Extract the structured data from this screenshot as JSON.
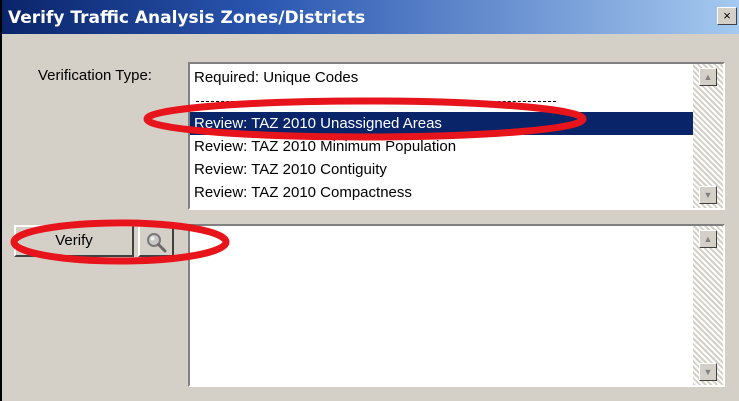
{
  "window": {
    "title": "Verify Traffic Analysis Zones/Districts",
    "close_glyph": "×"
  },
  "verification": {
    "label": "Verification Type:",
    "items": [
      {
        "label": "Required: Unique Codes",
        "selected": false
      },
      {
        "label": "Review: TAZ 2010 Unassigned Areas",
        "selected": true
      },
      {
        "label": "Review: TAZ 2010 Minimum Population",
        "selected": false
      },
      {
        "label": "Review: TAZ 2010 Contiguity",
        "selected": false
      },
      {
        "label": "Review: TAZ 2010 Compactness",
        "selected": false
      }
    ]
  },
  "actions": {
    "verify_label": "Verify",
    "find_icon": "magnifier-icon"
  },
  "output": {
    "text": ""
  },
  "icons": {
    "scroll_up": "▲",
    "scroll_down": "▼"
  },
  "colors": {
    "selection": "#0a246a",
    "annotation": "#e8141c",
    "title_start": "#0a246a",
    "title_end": "#a6caf0"
  }
}
